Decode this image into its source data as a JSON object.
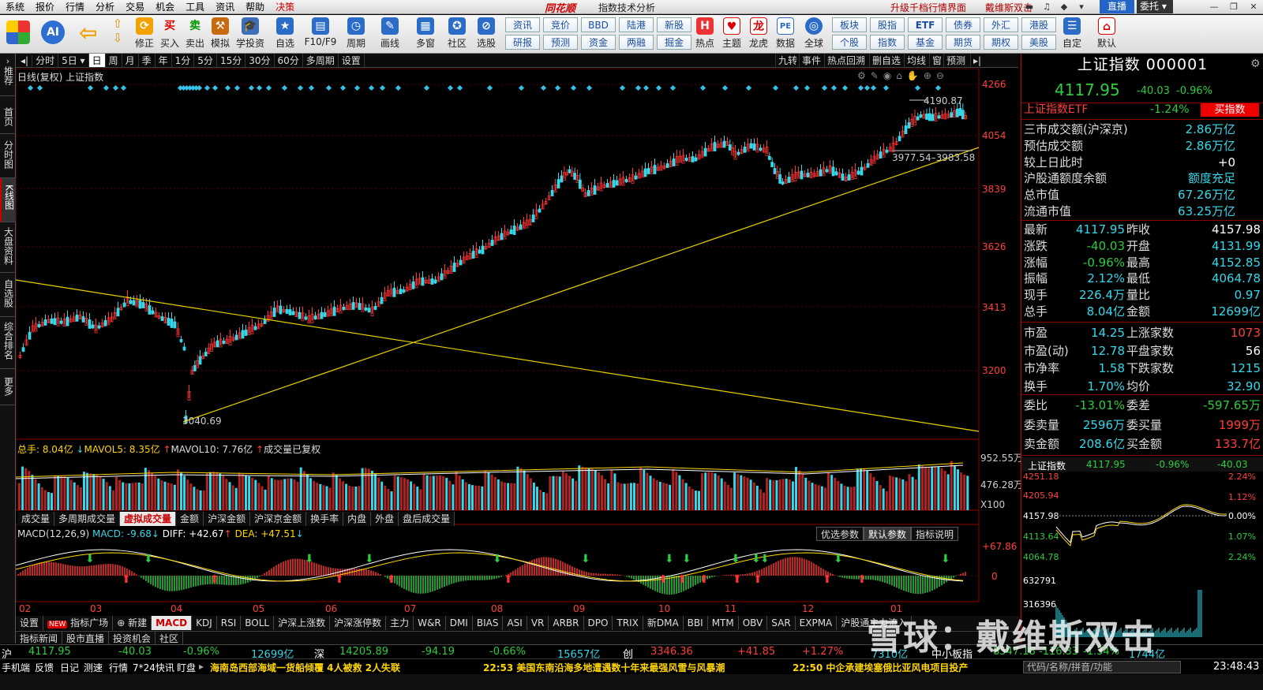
{
  "menu": {
    "items": [
      "系统",
      "报价",
      "行情",
      "分析",
      "交易",
      "机会",
      "工具",
      "资讯",
      "帮助"
    ],
    "decision": "决策",
    "brand": "同花顺",
    "app_title": "指数技术分析",
    "upgrade": "升级千档行情界面",
    "promo": "戴维斯双击",
    "live": "直播",
    "trust": "委托"
  },
  "toolbar": {
    "buttons": [
      "修正",
      "买入",
      "卖出",
      "模拟",
      "学投资",
      "自选",
      "F10/F9",
      "周期",
      "画线",
      "多窗",
      "社区",
      "选股",
      "热点",
      "主题",
      "龙虎",
      "数据",
      "全球",
      "自定",
      "默认"
    ],
    "quick_row1": [
      "资讯",
      "竞价",
      "BBD",
      "陆港",
      "新股",
      "板块",
      "股指",
      "ETF",
      "债券",
      "外汇",
      "港股"
    ],
    "quick_row2": [
      "研报",
      "预测",
      "资金",
      "两融",
      "掘金",
      "个股",
      "指数",
      "基金",
      "期货",
      "期权",
      "美股"
    ]
  },
  "sidetabs": [
    "推荐",
    "首页",
    "分时图",
    "K线图",
    "大盘资料",
    "自选股",
    "综合排名",
    "更多"
  ],
  "periodbar": {
    "items": [
      "分时",
      "5日",
      "日",
      "周",
      "月",
      "季",
      "年",
      "1分",
      "5分",
      "15分",
      "30分",
      "60分",
      "多周期",
      "设置"
    ],
    "right": [
      "九转",
      "事件",
      "热点回溯",
      "删自选",
      "均线",
      "窗",
      "预测"
    ]
  },
  "chart": {
    "header": "日线(复权)  上证指数",
    "price_axis": [
      "4266",
      "4054",
      "3839",
      "3626",
      "3413",
      "3200"
    ],
    "annot_high": "4190.87",
    "annot_low": "3040.69",
    "annot_range": "3977.54–3983.58",
    "volume_header": {
      "total": "总手: 8.04亿",
      "mavol5": "MAVOL5: 8.35亿",
      "mavol10": "MAVOL10: 7.76亿",
      "note": "成交量已复权"
    },
    "volume_axis": [
      "952.55万",
      "476.28万",
      "X100"
    ],
    "volume_tabs": [
      "成交量",
      "多周期成交量",
      "虚拟成交量",
      "金额",
      "沪深金额",
      "沪深京金额",
      "换手率",
      "内盘",
      "外盘",
      "盘后成交量"
    ],
    "macd_header": {
      "name": "MACD(12,26,9)",
      "macd": "MACD: -9.68",
      "diff": "DIFF: +42.67",
      "dea": "DEA: +47.51"
    },
    "macd_buttons": [
      "优选参数",
      "默认参数",
      "指标说明"
    ],
    "macd_axis": [
      "+67.86",
      "0"
    ],
    "months": [
      "02",
      "03",
      "04",
      "05",
      "06",
      "07",
      "08",
      "09",
      "10",
      "11",
      "12",
      "01"
    ]
  },
  "indicator_tabs": [
    "设置",
    "指标广场",
    "新建",
    "MACD",
    "KDJ",
    "RSI",
    "BOLL",
    "沪深上涨数",
    "沪深涨停数",
    "主力",
    "W&R",
    "DMI",
    "BIAS",
    "ASI",
    "VR",
    "ARBR",
    "DPO",
    "TRIX",
    "新DMA",
    "BBI",
    "MTM",
    "OBV",
    "SAR",
    "EXPMA",
    "沪股通主力流入"
  ],
  "new_badge": "NEW",
  "bottom_tabs": [
    "指标新闻",
    "股市直播",
    "投资机会",
    "社区"
  ],
  "panel": {
    "title": "上证指数 000001",
    "price": "4117.95",
    "change": "-40.03",
    "pct": "-0.96%",
    "etf": {
      "name": "上证指数ETF",
      "pct": "-1.24%",
      "btn": "买指数"
    },
    "stats1": [
      [
        "三市成交额(沪深京)",
        "2.86万亿"
      ],
      [
        "预估成交额",
        "2.86万亿"
      ],
      [
        "较上日此时",
        "+0"
      ],
      [
        "沪股通额度余额",
        "额度充足"
      ],
      [
        "总市值",
        "67.26万亿"
      ],
      [
        "流通市值",
        "63.25万亿"
      ]
    ],
    "stats2": [
      [
        "最新",
        "4117.95",
        "昨收",
        "4157.98"
      ],
      [
        "涨跌",
        "-40.03",
        "开盘",
        "4131.99"
      ],
      [
        "涨幅",
        "-0.96%",
        "最高",
        "4152.85"
      ],
      [
        "振幅",
        "2.12%",
        "最低",
        "4064.78"
      ],
      [
        "现手",
        "226.4万",
        "量比",
        "0.97"
      ],
      [
        "总手",
        "8.04亿",
        "金额",
        "12699亿"
      ]
    ],
    "stats3": [
      [
        "市盈",
        "14.25",
        "上涨家数",
        "1073"
      ],
      [
        "市盈(动)",
        "12.78",
        "平盘家数",
        "56"
      ],
      [
        "市净率",
        "1.58",
        "下跌家数",
        "1215"
      ],
      [
        "换手",
        "1.70%",
        "均价",
        "32.90"
      ]
    ],
    "stats4": [
      [
        "委比",
        "-13.01%",
        "委差",
        "-597.65万"
      ],
      [
        "委卖量",
        "2596万",
        "委买量",
        "1999万"
      ],
      [
        "卖金额",
        "208.6亿",
        "买金额",
        "133.7亿"
      ]
    ],
    "mini": {
      "name": "上证指数",
      "price": "4117.95",
      "pct": "-0.96%",
      "chg": "-40.03",
      "y_left": [
        "4251.18",
        "4205.94",
        "4157.98",
        "4113.64",
        "4064.78",
        "632791",
        "316396"
      ],
      "y_right": [
        "2.24%",
        "1.12%",
        "0.00%",
        "1.07%",
        "2.24%"
      ]
    }
  },
  "ticker": {
    "items": [
      [
        "沪",
        "4117.95",
        "-40.03",
        "-0.96%",
        "12699亿"
      ],
      [
        "深",
        "14205.89",
        "-94.19",
        "-0.66%",
        "15657亿"
      ],
      [
        "创",
        "3346.36",
        "+41.85",
        "+1.27%",
        "7310亿"
      ]
    ],
    "extra": [
      "中小板指",
      "8547.18",
      "-116.33",
      "-1.34%",
      "1744亿"
    ]
  },
  "statusbar": {
    "left": [
      "手机端",
      "反馈",
      "日记",
      "测速",
      "行情",
      "7*24快讯",
      "盯盘"
    ],
    "news": [
      "海南岛西部海域一货船倾覆 4人被救 2人失联",
      "22:53 美国东南沿海多地遭遇数十年来最强风雪与风暴潮",
      "22:50 中企承建埃塞俄比亚风电项目投产"
    ],
    "search": "代码/名称/拼音/功能",
    "time": "23:48:43"
  },
  "watermark": "雪球：戴维斯双击"
}
